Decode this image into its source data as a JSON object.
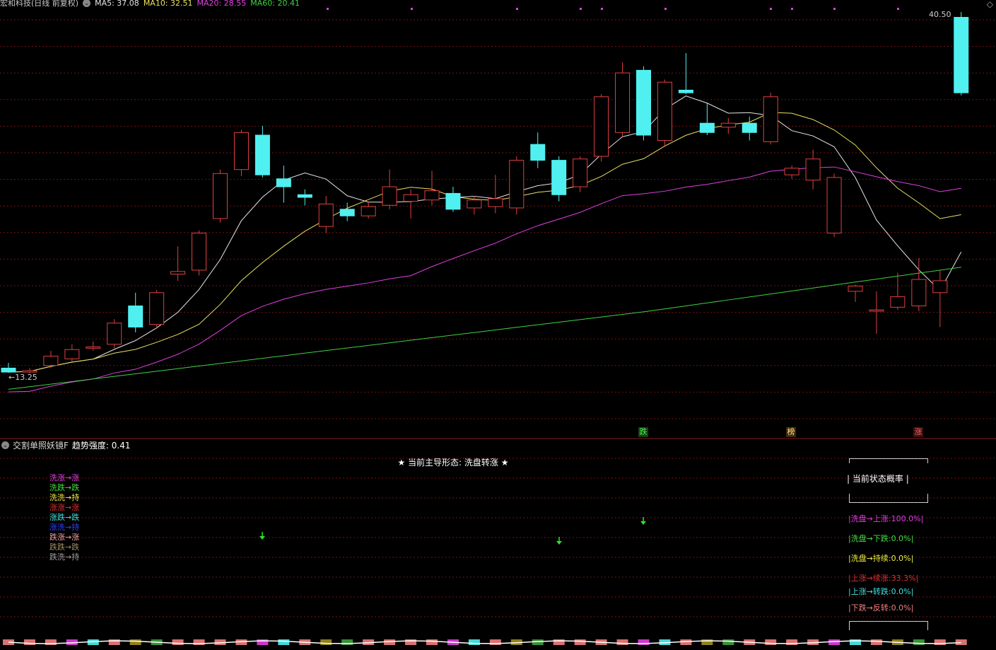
{
  "header": {
    "title": "宏和科技(日线 前复权)",
    "ma5": "MA5: 37.08",
    "ma10": "MA10: 32.51",
    "ma20": "MA20: 28.55",
    "ma60": "MA60: 20.41"
  },
  "price_labels": {
    "high": "40.50",
    "low": "13.25"
  },
  "signals": [
    {
      "label": "跌",
      "color": "#40ff40",
      "bg": "#1a3a1a"
    },
    {
      "label": "榜",
      "color": "#ffe080",
      "bg": "#3a2a10"
    },
    {
      "label": "涨",
      "color": "#ff6060",
      "bg": "#3a1010"
    }
  ],
  "sub_header": {
    "name": "交割单照妖镜F",
    "strength": "趋势强度: 0.41"
  },
  "dominant_state": "★ 当前主导形态: 洗盘转涨 ★",
  "legend": [
    {
      "text": "洗涨→涨",
      "color": "#e040e0"
    },
    {
      "text": "洗跌→跌",
      "color": "#40e040"
    },
    {
      "text": "洗洗→持",
      "color": "#f0f040"
    },
    {
      "text": "涨涨→涨",
      "color": "#e03030"
    },
    {
      "text": "涨跌→跌",
      "color": "#40e0e0"
    },
    {
      "text": "涨洗→持",
      "color": "#3040ff"
    },
    {
      "text": "跌涨→涨",
      "color": "#f0a0a0"
    },
    {
      "text": "跌跌→跌",
      "color": "#a09060"
    },
    {
      "text": "跌洗→持",
      "color": "#a0a0a0"
    }
  ],
  "probability": {
    "title": "当前状态概率",
    "items": [
      {
        "text": "洗盘→上涨:100.0%",
        "color": "#e040e0"
      },
      {
        "text": "洗盘→下跌:0.0%",
        "color": "#40e040"
      },
      {
        "text": "洗盘→持续:0.0%",
        "color": "#f0f040"
      },
      {
        "text": "上涨→续涨:33.3%",
        "color": "#e03030"
      },
      {
        "text": "上涨→转跌:0.0%",
        "color": "#40e0e0"
      },
      {
        "text": "下跌→反转:0.0%",
        "color": "#f08080"
      }
    ]
  },
  "colors": {
    "up": "#e04040",
    "down": "#50f0f0",
    "ma5": "#e6e6e6",
    "ma10": "#e8e060",
    "ma20": "#e040e0",
    "ma60": "#40d040",
    "grid": "#7a1010"
  },
  "chart_data": {
    "type": "candlestick",
    "title": "宏和科技(日线 前复权)",
    "candles": [
      [
        13.6,
        13.3,
        14.0,
        13.25
      ],
      [
        13.3,
        13.4,
        13.6,
        13.2
      ],
      [
        13.8,
        14.5,
        14.9,
        13.6
      ],
      [
        14.3,
        15.0,
        15.4,
        14.1
      ],
      [
        15.1,
        15.2,
        15.6,
        14.9
      ],
      [
        15.4,
        17.0,
        17.3,
        15.1
      ],
      [
        18.3,
        16.7,
        19.3,
        16.3
      ],
      [
        16.9,
        19.3,
        19.5,
        16.6
      ],
      [
        20.7,
        20.9,
        22.8,
        20.2
      ],
      [
        21.0,
        23.8,
        24.0,
        20.6
      ],
      [
        24.9,
        28.3,
        28.6,
        24.6
      ],
      [
        28.6,
        31.4,
        31.6,
        28.1
      ],
      [
        31.2,
        28.2,
        31.9,
        28.0
      ],
      [
        27.9,
        27.3,
        28.9,
        26.1
      ],
      [
        26.7,
        26.5,
        27.1,
        25.9
      ],
      [
        24.3,
        26.0,
        26.6,
        23.8
      ],
      [
        25.6,
        25.1,
        26.1,
        24.7
      ],
      [
        25.1,
        25.8,
        26.2,
        24.9
      ],
      [
        25.9,
        27.3,
        28.6,
        25.6
      ],
      [
        26.2,
        26.7,
        27.1,
        24.9
      ],
      [
        26.3,
        27.0,
        28.5,
        25.9
      ],
      [
        26.8,
        25.6,
        27.3,
        25.4
      ],
      [
        25.7,
        26.3,
        26.6,
        25.2
      ],
      [
        25.8,
        26.4,
        28.2,
        25.3
      ],
      [
        25.7,
        29.3,
        29.6,
        25.2
      ],
      [
        30.5,
        29.3,
        31.4,
        28.7
      ],
      [
        29.3,
        26.7,
        29.6,
        26.2
      ],
      [
        27.3,
        29.4,
        29.6,
        26.9
      ],
      [
        29.6,
        34.1,
        34.3,
        29.2
      ],
      [
        31.4,
        35.9,
        36.7,
        31.1
      ],
      [
        36.1,
        31.2,
        36.4,
        30.8
      ],
      [
        30.8,
        35.2,
        35.4,
        30.3
      ],
      [
        34.6,
        34.4,
        37.4,
        34.3
      ],
      [
        32.1,
        31.4,
        33.6,
        31.2
      ],
      [
        31.8,
        32.1,
        32.5,
        31.3
      ],
      [
        32.1,
        31.4,
        32.6,
        30.8
      ],
      [
        30.7,
        34.1,
        34.4,
        30.5
      ],
      [
        28.2,
        28.7,
        28.9,
        27.9
      ],
      [
        27.8,
        29.4,
        30.1,
        27.1
      ],
      [
        23.8,
        28.0,
        28.3,
        23.5
      ],
      [
        19.4,
        19.8,
        19.9,
        18.6
      ],
      [
        17.9,
        18.0,
        19.4,
        16.2
      ],
      [
        18.2,
        19.0,
        20.8,
        18.0
      ],
      [
        18.3,
        20.3,
        21.9,
        17.9
      ],
      [
        19.3,
        20.2,
        21.0,
        16.7
      ],
      [
        40.1,
        34.4,
        40.5,
        34.2
      ]
    ],
    "note_candles": "[open, close, high, low] per bar, approximate",
    "ylim": [
      13.25,
      40.5
    ]
  },
  "subchart": {
    "arrows_count": 3
  }
}
